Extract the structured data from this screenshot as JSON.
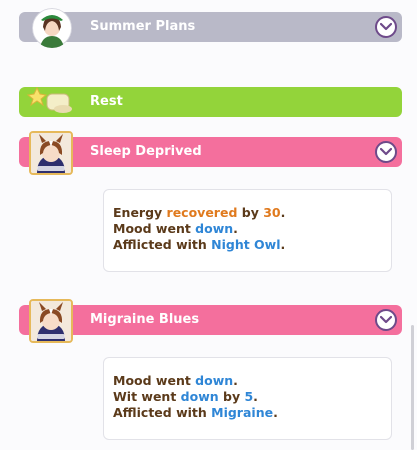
{
  "events": {
    "summer": {
      "title": "Summer Plans"
    },
    "rest": {
      "title": "Rest"
    },
    "sleep": {
      "title": "Sleep Deprived",
      "line1": {
        "a": "Energy ",
        "b": "recovered",
        "c": " by ",
        "d": "30",
        "e": "."
      },
      "line2": {
        "a": "Mood went ",
        "b": "down",
        "c": "."
      },
      "line3": {
        "a": "Afflicted with ",
        "b": "Night Owl",
        "c": "."
      }
    },
    "migraine": {
      "title": "Migraine Blues",
      "line1": {
        "a": "Mood went ",
        "b": "down",
        "c": "."
      },
      "line2": {
        "a": "Wit went ",
        "b": "down",
        "c": " by ",
        "d": "5",
        "e": "."
      },
      "line3": {
        "a": "Afflicted with ",
        "b": "Migraine",
        "c": "."
      }
    }
  },
  "colors": {
    "gray_bar": "#b9b9c8",
    "green_bar": "#93d43a",
    "pink_bar": "#f46f9d",
    "up_text": "#e07a1e",
    "down_text": "#2f86d6",
    "body_text": "#5b3a1a"
  },
  "icons": {
    "expand": "chevron-down-icon",
    "character": "character-portrait",
    "trainer": "trainer-avatar",
    "rest": "rest-icon"
  }
}
